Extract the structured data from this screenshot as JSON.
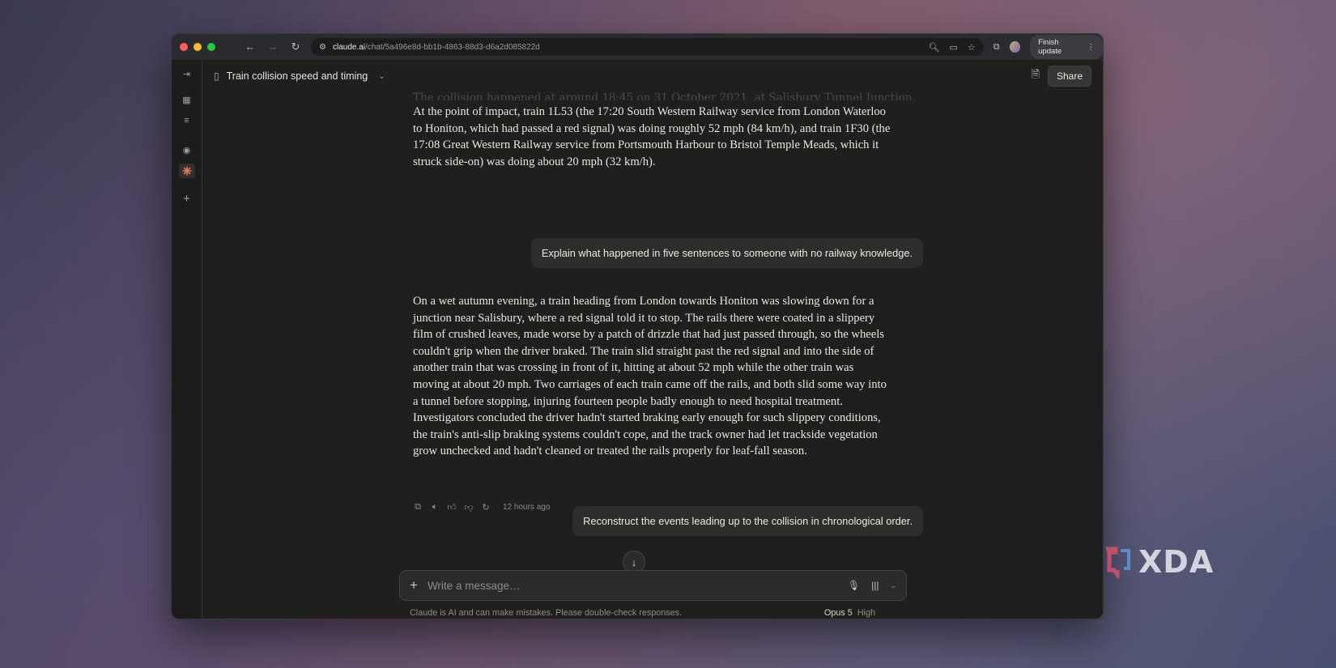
{
  "browser": {
    "url_host": "claude.ai",
    "url_path": "/chat/5a496e8d-bb1b-4863-88d3-d6a2d085822d",
    "finish_update_label": "Finish update"
  },
  "header": {
    "title": "Train collision speed and timing",
    "share_label": "Share"
  },
  "chat": {
    "faded_text": "The collision happened at around 18:45 on 31 October 2021, at Salisbury Tunnel Junction.",
    "ai_message_1": "At the point of impact, train 1L53 (the 17:20 South Western Railway service from London Waterloo to Honiton, which had passed a red signal) was doing roughly 52 mph (84 km/h), and train 1F30 (the 17:08 Great Western Railway service from Portsmouth Harbour to Bristol Temple Meads, which it struck side-on) was doing about 20 mph (32 km/h).",
    "user_message_1": "Explain what happened in five sentences to someone with no railway knowledge.",
    "ai_message_2": "On a wet autumn evening, a train heading from London towards Honiton was slowing down for a junction near Salisbury, where a red signal told it to stop. The rails there were coated in a slippery film of crushed leaves, made worse by a patch of drizzle that had just passed through, so the wheels couldn't grip when the driver braked. The train slid straight past the red signal and into the side of another train that was crossing in front of it, hitting at about 52 mph while the other train was moving at about 20 mph. Two carriages of each train came off the rails, and both slid some way into a tunnel before stopping, injuring fourteen people badly enough to need hospital treatment. Investigators concluded the driver hadn't started braking early enough for such slippery conditions, the train's anti-slip braking systems couldn't cope, and the track owner had let trackside vegetation grow unchecked and hadn't cleaned or treated the rails properly for leaf-fall season.",
    "timestamp": "12 hours ago",
    "user_message_2": "Reconstruct the events leading up to the collision in chronological order."
  },
  "composer": {
    "placeholder": "Write a message…",
    "disclaimer": "Claude is AI and can make mistakes. Please double-check responses.",
    "model": "Opus 5",
    "effort": "High"
  },
  "watermark": {
    "text": "XDA"
  },
  "colors": {
    "close": "#ff5f57",
    "minimize": "#febc2e",
    "maximize": "#28c840",
    "claude_accent": "#d97757"
  }
}
